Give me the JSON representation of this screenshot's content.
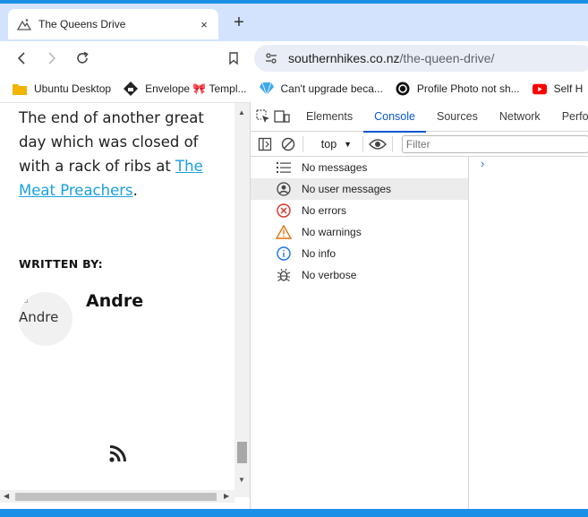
{
  "browser": {
    "tab": {
      "title": "The Queens Drive",
      "favicon": "mountain-icon",
      "close_label": "×"
    },
    "new_tab_label": "+",
    "address": {
      "host": "southernhikes.co.nz",
      "path": "/the-queen-drive/"
    },
    "bookmarks": [
      {
        "label": "Ubuntu Desktop",
        "icon": "folder-icon"
      },
      {
        "label": "Envelope 🎀 Templ...",
        "icon": "envelope-icon"
      },
      {
        "label": "Can't upgrade beca...",
        "icon": "diamond-icon"
      },
      {
        "label": "Profile Photo not sh...",
        "icon": "circle-logo-icon"
      },
      {
        "label": "Self H",
        "icon": "youtube-icon"
      }
    ]
  },
  "page": {
    "article_text_before": "The end of another great day which was closed of with a rack of ribs at ",
    "article_link": "The Meat Preachers",
    "article_text_after": ".",
    "written_by": "WRITTEN BY:",
    "avatar_alt": "Andre",
    "author_name": "Andre",
    "link_color": "#1aa0e0"
  },
  "devtools": {
    "tabs": [
      "Elements",
      "Console",
      "Sources",
      "Network",
      "Perfo"
    ],
    "active_tab": "Console",
    "context": "top",
    "filter_placeholder": "Filter",
    "sidebar_items": [
      {
        "label": "No messages",
        "icon": "list-icon"
      },
      {
        "label": "No user messages",
        "icon": "user-circle-icon"
      },
      {
        "label": "No errors",
        "icon": "error-icon"
      },
      {
        "label": "No warnings",
        "icon": "warning-icon"
      },
      {
        "label": "No info",
        "icon": "info-icon"
      },
      {
        "label": "No verbose",
        "icon": "bug-icon"
      }
    ],
    "prompt": "›",
    "accent": "#0b57d0",
    "error_color": "#d93025",
    "warning_color": "#e8710a",
    "info_color": "#1a73e8"
  }
}
